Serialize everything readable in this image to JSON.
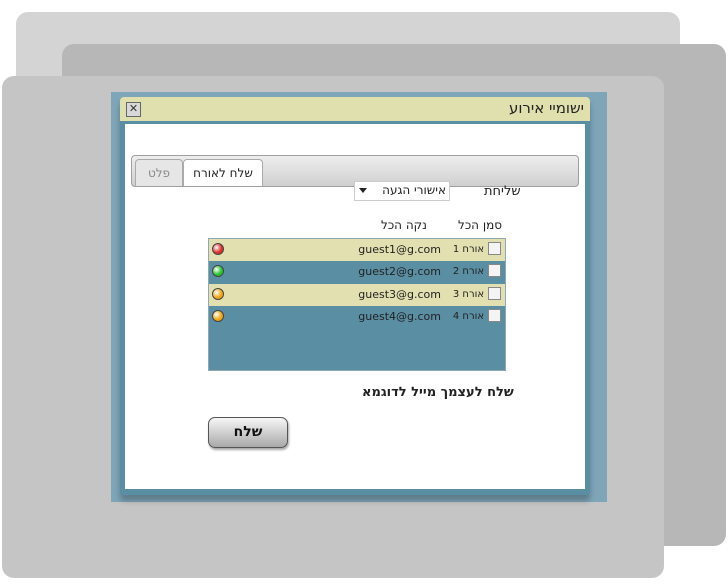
{
  "dialog": {
    "title": "ישומיי אירוע",
    "close_glyph": "✕"
  },
  "tabs": [
    {
      "label": "שלח לאורח",
      "active": true
    },
    {
      "label": "פלט",
      "active": false
    }
  ],
  "form": {
    "send_label": "שליחת",
    "send_type": {
      "selected": "אישורי הגעה"
    },
    "select_all": "סמן הכל",
    "clear_all": "נקה הכל"
  },
  "guests": [
    {
      "name": "אורח 1",
      "email": "guest1@g.com",
      "status": "red",
      "status_color": "#d9302a"
    },
    {
      "name": "אורח 2",
      "email": "guest2@g.com",
      "status": "green",
      "status_color": "#27c42d"
    },
    {
      "name": "אורח 3",
      "email": "guest3@g.com",
      "status": "orange",
      "status_color": "#f2a516"
    },
    {
      "name": "אורח 4",
      "email": "guest4@g.com",
      "status": "orange",
      "status_color": "#f2a516"
    }
  ],
  "sample_email_text": "שלח לעצמך מייל לדוגמא",
  "send_button": "שלח",
  "colors": {
    "titlebar": "#e0dfae",
    "dialog_blue": "#5a8ea3",
    "row_light": "#e2e0b0"
  }
}
